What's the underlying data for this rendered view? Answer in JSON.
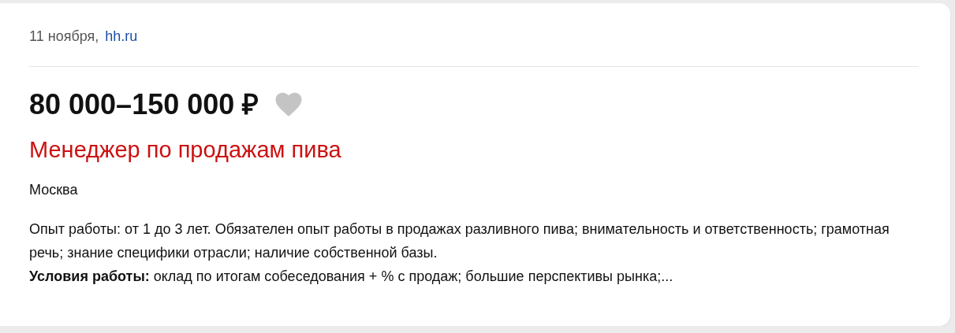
{
  "card": {
    "date": "11 ноября,",
    "source": "hh.ru",
    "salary": "80 000–150 000 ₽",
    "favorite": false,
    "title": "Менеджер по продажам пива",
    "city": "Москва",
    "description": [
      "Опыт работы: от 1 до 3 лет. Обязателен опыт работы в продажах разливного пива; внимательность и ответственность; грамотная речь; знание специфики отрасли; наличие собственной базы.",
      "**Условия работы:** оклад по итогам собеседования + % с продаж; большие перспективы рынка;..."
    ]
  }
}
